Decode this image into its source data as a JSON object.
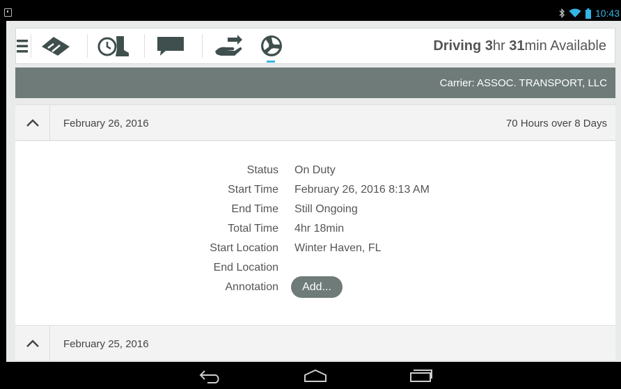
{
  "status_bar": {
    "time": "10:43",
    "icons": [
      "notification-icon",
      "bluetooth-icon",
      "wifi-icon",
      "battery-icon"
    ]
  },
  "toolbar": {
    "menu_icon": "menu-icon",
    "tools": [
      "road-icon",
      "clock-boot-icon",
      "message-icon",
      "hand-transfer-icon",
      "logs-icon"
    ],
    "active_tool": "logs-icon",
    "driving_label": "Driving",
    "driving_hours": "3",
    "driving_hours_unit": "hr",
    "driving_minutes": "31",
    "driving_minutes_unit": "min Available"
  },
  "carrier": {
    "text": "Carrier: ASSOC. TRANSPORT, LLC"
  },
  "days": [
    {
      "date": "February 26, 2016",
      "summary": "70 Hours over 8 Days",
      "expanded": true,
      "details": [
        {
          "label": "Status",
          "value": "On Duty"
        },
        {
          "label": "Start Time",
          "value": "February 26, 2016 8:13 AM"
        },
        {
          "label": "End Time",
          "value": "Still Ongoing"
        },
        {
          "label": "Total Time",
          "value": "4hr 18min"
        },
        {
          "label": "Start Location",
          "value": "Winter Haven, FL"
        },
        {
          "label": "End Location",
          "value": ""
        },
        {
          "label": "Annotation",
          "value": ""
        }
      ],
      "add_button_label": "Add..."
    },
    {
      "date": "February 25, 2016",
      "summary": "",
      "expanded": false
    }
  ],
  "colors": {
    "accent": "#33b5e5",
    "carrier_bar": "#6e7b79",
    "icon_dark": "#3f4f4d"
  },
  "nav_bar": {
    "buttons": [
      "back-icon",
      "home-icon",
      "recents-icon"
    ]
  }
}
